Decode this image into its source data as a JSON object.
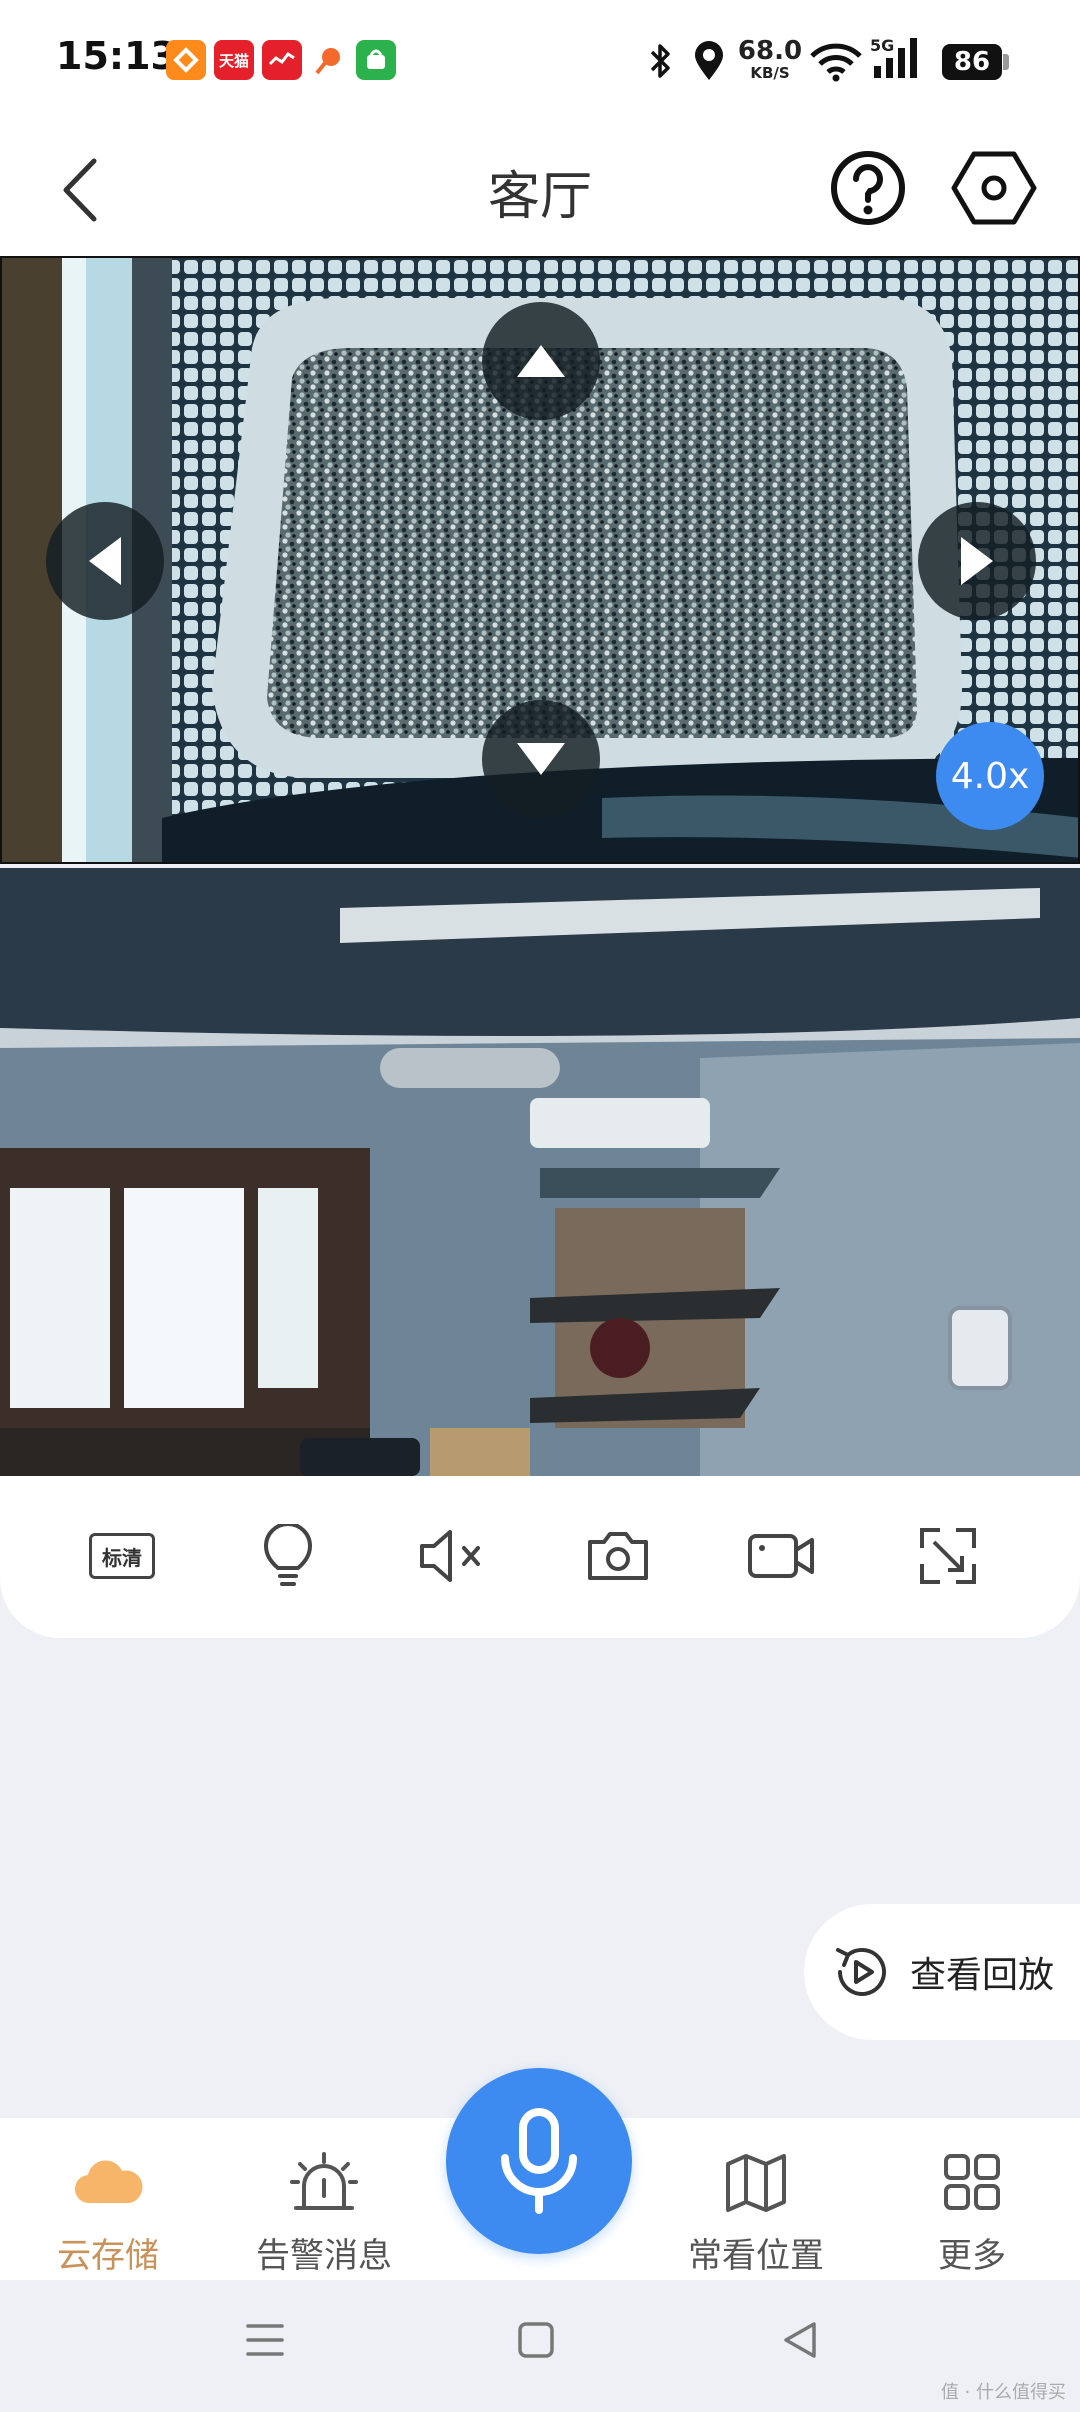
{
  "status_bar": {
    "time": "15:13",
    "app_icons": [
      "taobao-icon",
      "tmall-icon",
      "app-icon",
      "app-icon",
      "app-icon"
    ],
    "tmall_text": "天猫",
    "net_speed_value": "68.0",
    "net_speed_unit": "KB/S",
    "network": "5G",
    "battery": "86"
  },
  "header": {
    "title": "客厅",
    "back_icon": "chevron-left-icon",
    "help_icon": "help-icon",
    "settings_icon": "settings-icon"
  },
  "ptz_view": {
    "zoom": "4.0x",
    "controls": [
      "arrow-up-icon",
      "arrow-left-icon",
      "arrow-right-icon",
      "arrow-down-icon"
    ]
  },
  "controls": {
    "quality": "标清",
    "items": [
      "quality-button",
      "light-icon",
      "mute-icon",
      "snapshot-icon",
      "record-icon",
      "fullscreen-icon"
    ]
  },
  "playback": {
    "label": "查看回放",
    "icon": "replay-icon"
  },
  "tabbar": {
    "tabs": [
      {
        "label": "云存储",
        "icon": "cloud-icon",
        "active": true
      },
      {
        "label": "告警消息",
        "icon": "alarm-icon"
      },
      {
        "label": "常看位置",
        "icon": "map-icon"
      },
      {
        "label": "更多",
        "icon": "grid-icon"
      }
    ],
    "mic_icon": "microphone-icon"
  },
  "colors": {
    "accent": "#3d8af0",
    "active_tab": "#c9925a",
    "cloud": "#f7b569"
  },
  "watermark": "值 · 什么值得买"
}
